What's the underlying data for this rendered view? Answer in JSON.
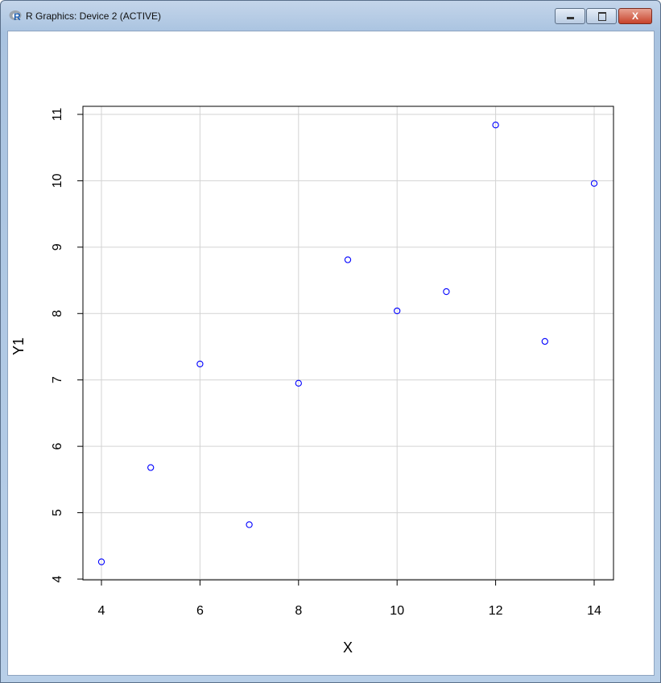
{
  "window": {
    "title": "R Graphics: Device 2 (ACTIVE)",
    "close_glyph": "X"
  },
  "chart_data": {
    "type": "scatter",
    "title": "",
    "xlabel": "X",
    "ylabel": "Y1",
    "xlim": [
      4,
      14
    ],
    "ylim": [
      4,
      11
    ],
    "xticks": [
      4,
      6,
      8,
      10,
      12,
      14
    ],
    "yticks": [
      4,
      5,
      6,
      7,
      8,
      9,
      10,
      11
    ],
    "grid": true,
    "x": [
      10,
      8,
      13,
      9,
      11,
      14,
      6,
      4,
      12,
      7,
      5
    ],
    "y": [
      8.04,
      6.95,
      7.58,
      8.81,
      8.33,
      9.96,
      7.24,
      4.26,
      10.84,
      4.82,
      5.68
    ],
    "point_color": "#0000ff",
    "grid_color": "#d3d3d3"
  }
}
